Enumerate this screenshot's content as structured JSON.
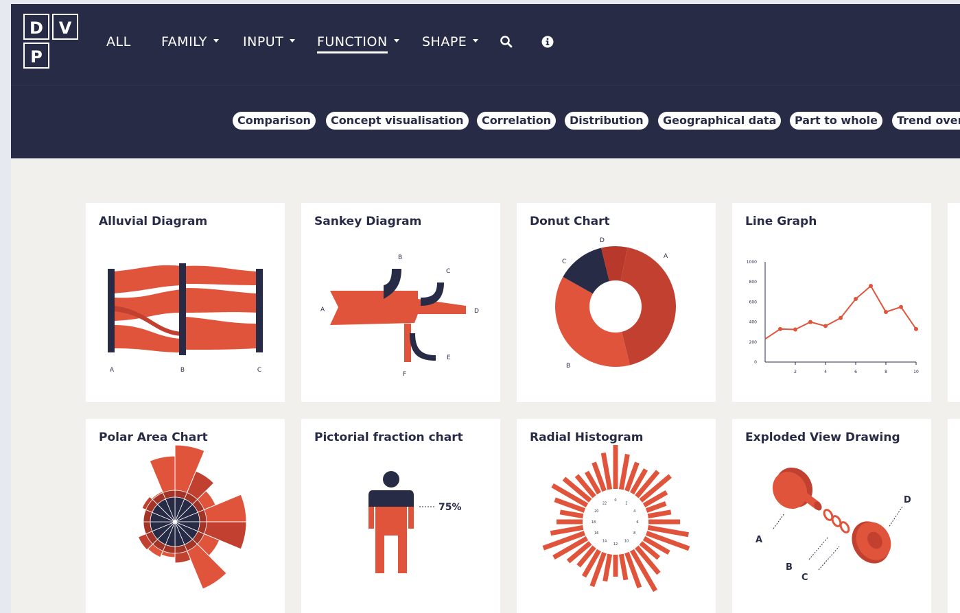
{
  "logo": {
    "letters": [
      "D",
      "V",
      "P"
    ]
  },
  "nav": {
    "items": [
      {
        "label": "ALL",
        "has_caret": false,
        "active": false
      },
      {
        "label": "FAMILY",
        "has_caret": true,
        "active": false
      },
      {
        "label": "INPUT",
        "has_caret": true,
        "active": false
      },
      {
        "label": "FUNCTION",
        "has_caret": true,
        "active": true
      },
      {
        "label": "SHAPE",
        "has_caret": true,
        "active": false
      }
    ],
    "icons": [
      "search-icon",
      "info-icon"
    ]
  },
  "filters": [
    "Comparison",
    "Concept visualisation",
    "Correlation",
    "Distribution",
    "Geographical data",
    "Part to whole",
    "Trend over"
  ],
  "colors": {
    "navy": "#272b46",
    "coral": "#e0543c",
    "coral_dark": "#b8382b",
    "page_bg": "#f2f0ed"
  },
  "cards": [
    {
      "title": "Alluvial Diagram",
      "labels": [
        "A",
        "B",
        "C"
      ]
    },
    {
      "title": "Sankey Diagram",
      "labels": [
        "A",
        "B",
        "C",
        "D",
        "E",
        "F"
      ]
    },
    {
      "title": "Donut Chart",
      "labels": [
        "A",
        "B",
        "C",
        "D"
      ]
    },
    {
      "title": "Line Graph",
      "y_ticks": [
        "1000",
        "800",
        "600",
        "400",
        "200",
        "0"
      ],
      "x_ticks": [
        "2",
        "4",
        "6",
        "8",
        "10"
      ]
    },
    {
      "title": "Polar Area Chart"
    },
    {
      "title": "Pictorial fraction chart",
      "value_label": "75%"
    },
    {
      "title": "Radial Histogram",
      "ring_labels": [
        "0",
        "2",
        "4",
        "6",
        "8",
        "10",
        "12",
        "14",
        "16",
        "18",
        "20",
        "22"
      ]
    },
    {
      "title": "Exploded View Drawing",
      "labels": [
        "A",
        "B",
        "C",
        "D"
      ]
    }
  ],
  "chart_data": [
    {
      "type": "line",
      "x": [
        0,
        1,
        2,
        3,
        4,
        5,
        6,
        7,
        8,
        9,
        10
      ],
      "y": [
        230,
        330,
        325,
        400,
        360,
        440,
        630,
        760,
        500,
        550,
        330
      ],
      "ylim": [
        0,
        1000
      ],
      "xlim": [
        0,
        10
      ]
    },
    {
      "type": "pie",
      "labels": [
        "A",
        "B",
        "C",
        "D"
      ],
      "values": [
        43,
        37,
        13,
        7
      ]
    }
  ]
}
